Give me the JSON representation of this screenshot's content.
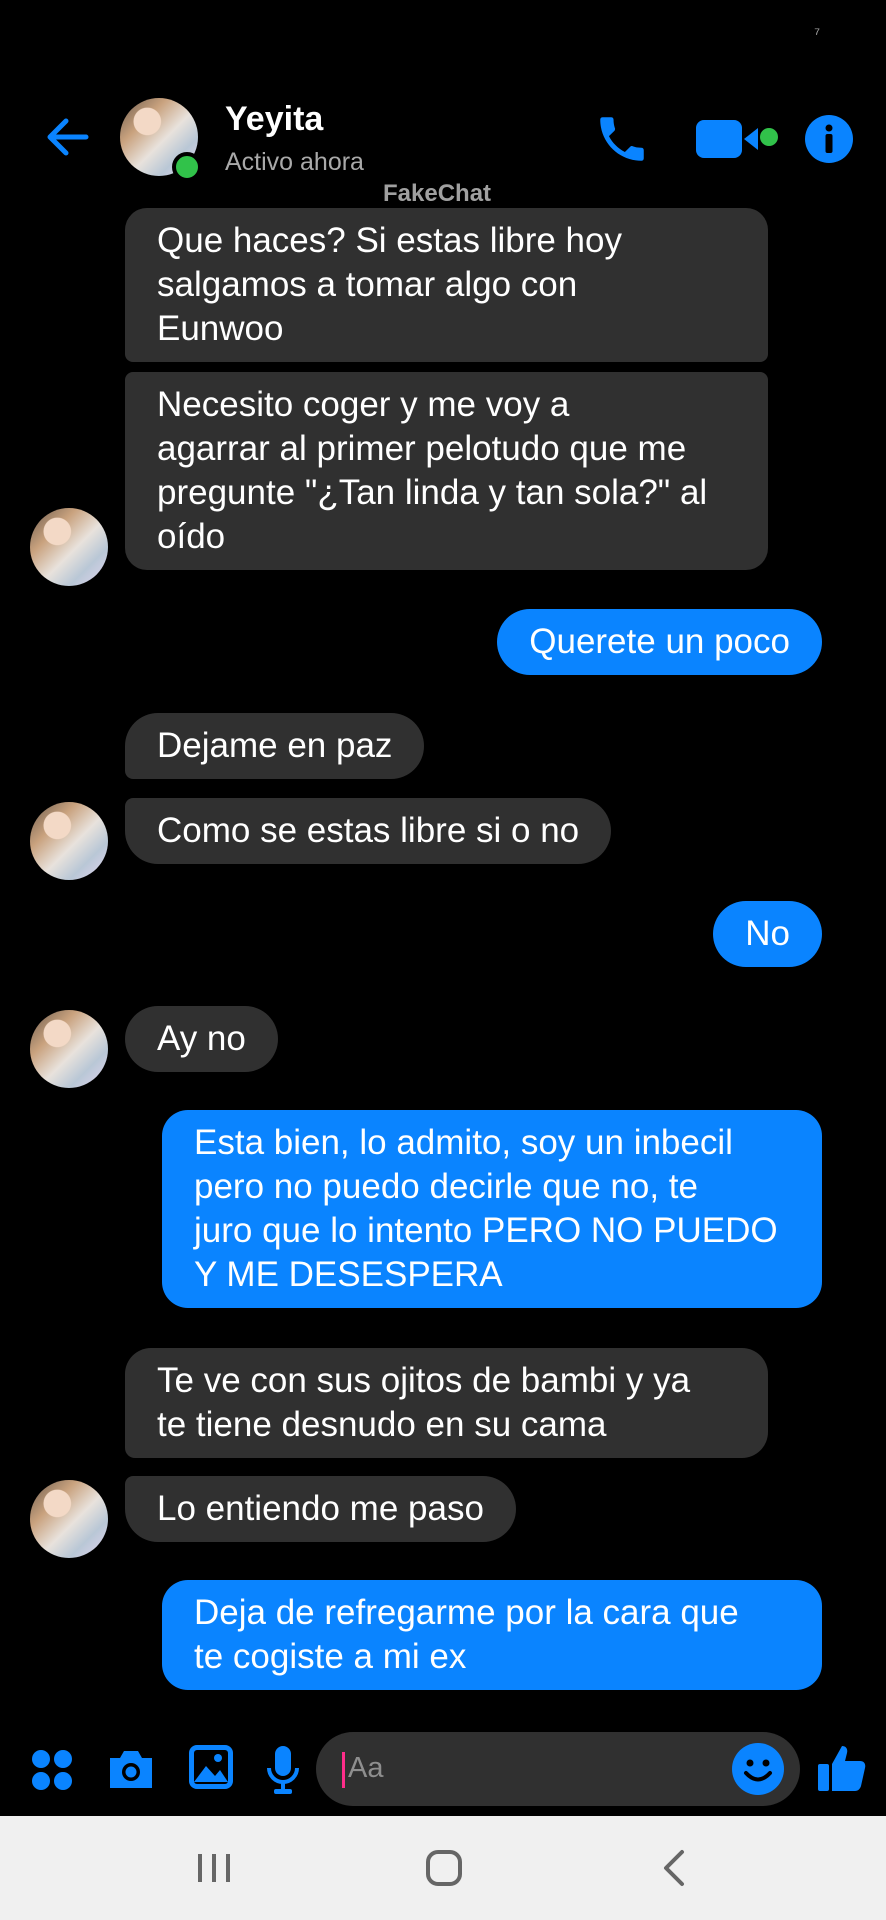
{
  "status_bar": {
    "glyph": "⁷"
  },
  "header": {
    "contact_name": "Yeyita",
    "contact_status": "Activo ahora",
    "watermark": "FakeChat"
  },
  "messages": [
    {
      "from": "them",
      "text": "Que haces? Si estas libre hoy\nsalgamos a tomar algo con\nEunwoo"
    },
    {
      "from": "them",
      "text": "Necesito coger y me voy a\nagarrar al primer pelotudo que me\npregunte \"¿Tan linda y tan sola?\" al\noído"
    },
    {
      "from": "me",
      "text": "Querete un poco"
    },
    {
      "from": "them",
      "text": "Dejame en paz"
    },
    {
      "from": "them",
      "text": "Como se estas libre si o no"
    },
    {
      "from": "me",
      "text": "No"
    },
    {
      "from": "them",
      "text": "Ay no"
    },
    {
      "from": "me",
      "text": "Esta bien, lo admito, soy un inbecil\npero no puedo decirle que no, te\njuro que lo intento PERO NO PUEDO\nY ME DESESPERA"
    },
    {
      "from": "them",
      "text": "Te ve con sus ojitos de bambi y ya\nte tiene desnudo en su cama"
    },
    {
      "from": "them",
      "text": "Lo entiendo me paso"
    },
    {
      "from": "me",
      "text": "Deja de refregarme por la cara que\nte cogiste a mi ex"
    }
  ],
  "composer": {
    "placeholder": "Aa",
    "icons": [
      "apps-icon",
      "camera-icon",
      "gallery-icon",
      "microphone-icon",
      "emoji-icon",
      "like-icon"
    ]
  },
  "colors": {
    "accent": "#0a84ff",
    "incoming_bubble": "#303030",
    "online": "#31c24a",
    "background": "#000000"
  }
}
